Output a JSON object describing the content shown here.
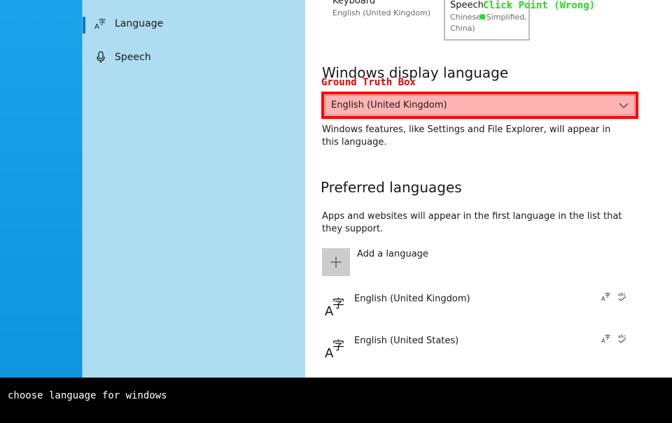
{
  "sidebar": {
    "items": [
      {
        "label": "Language",
        "icon": "language-icon",
        "selected": true
      },
      {
        "label": "Speech",
        "icon": "microphone-icon",
        "selected": false
      }
    ]
  },
  "tiles": {
    "keyboard": {
      "title": "Keyboard",
      "subtitle": "English (United Kingdom)"
    },
    "speech": {
      "title": "Speech",
      "subtitle": "Chinese (Simplified, China)"
    }
  },
  "annotations": {
    "click_point": "Click Point (Wrong)",
    "ground_truth": "Ground Truth Box"
  },
  "display_language": {
    "heading": "Windows display language",
    "selected": "English (United Kingdom)",
    "description": "Windows features, like Settings and File Explorer, will appear in this language."
  },
  "preferred": {
    "heading": "Preferred languages",
    "description": "Apps and websites will appear in the first language in the list that they support.",
    "add_label": "Add a language",
    "languages": [
      {
        "name": "English (United Kingdom)"
      },
      {
        "name": "English (United States)"
      }
    ]
  },
  "caption": "choose language for windows",
  "colors": {
    "accent": "#0078d7",
    "ground_truth": "#ff0000",
    "click_point": "#22dd22"
  }
}
